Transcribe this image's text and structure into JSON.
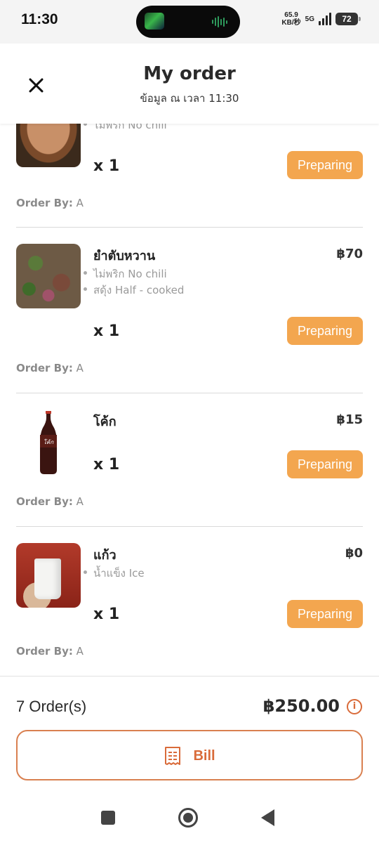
{
  "status_bar": {
    "time": "11:30",
    "speed_value": "65.9",
    "speed_unit": "KB/秒",
    "network": "5G",
    "battery": "72"
  },
  "header": {
    "title": "My order",
    "subtitle": "ข้อมูล ณ เวลา 11:30"
  },
  "orders": [
    {
      "name": "",
      "price": "",
      "options": [
        "ไม่พริก No chili"
      ],
      "quantity": "x 1",
      "status": "Preparing",
      "order_by_label": "Order By:",
      "order_by": "A",
      "image": "noodle-dish"
    },
    {
      "name": "ยำตับหวาน",
      "price": "฿70",
      "options": [
        "ไม่พริก No chili",
        "สดุ้ง Half - cooked"
      ],
      "quantity": "x 1",
      "status": "Preparing",
      "order_by_label": "Order By:",
      "order_by": "A",
      "image": "liver-salad"
    },
    {
      "name": "โค้ก",
      "price": "฿15",
      "options": [],
      "quantity": "x 1",
      "status": "Preparing",
      "order_by_label": "Order By:",
      "order_by": "A",
      "image": "coke-bottle"
    },
    {
      "name": "แก้ว",
      "price": "฿0",
      "options": [
        "น้ำแข็ง Ice"
      ],
      "quantity": "x 1",
      "status": "Preparing",
      "order_by_label": "Order By:",
      "order_by": "A",
      "image": "glass-cup"
    }
  ],
  "summary": {
    "order_count": "7 Order(s)",
    "total": "฿250.00",
    "bill_label": "Bill"
  },
  "colors": {
    "status_badge": "#f3a64f",
    "accent": "#d96b3a"
  },
  "icons": {
    "close": "close-icon",
    "info": "info-icon",
    "receipt": "receipt-icon",
    "nav_recents": "recents-icon",
    "nav_home": "home-icon",
    "nav_back": "back-icon"
  }
}
